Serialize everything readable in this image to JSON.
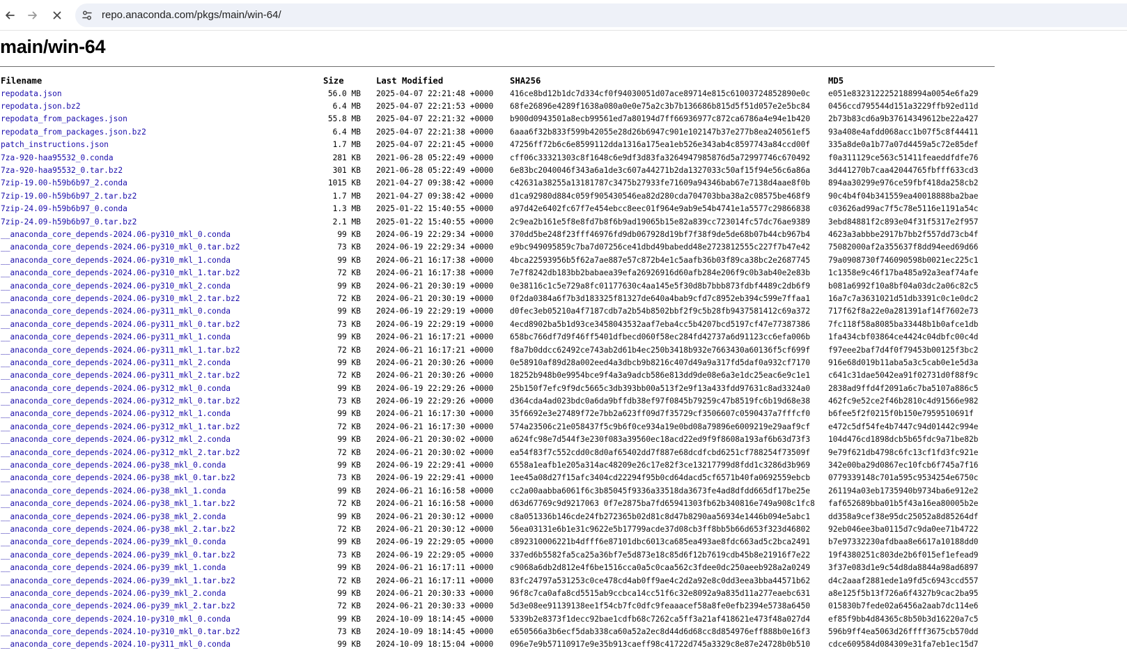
{
  "browser": {
    "url": "repo.anaconda.com/pkgs/main/win-64/"
  },
  "page": {
    "title": "main/win-64"
  },
  "table": {
    "headers": {
      "filename": "Filename",
      "size": "Size",
      "modified": "Last Modified",
      "sha256": "SHA256",
      "md5": "MD5"
    },
    "rows": [
      [
        "repodata.json",
        "56.0 MB",
        "2025-04-07 22:21:48 +0000",
        "416ce8bd12b1dc7d334cf0f94030051d07ace89714e815c61003724852890e0c",
        "e051e8323122252188994a0054e6fa29"
      ],
      [
        "repodata.json.bz2",
        "6.4 MB",
        "2025-04-07 22:21:53 +0000",
        "68fe26896e4289f1638a080a0e0e75a2c3b7b136686b815d5f51d057e2e5bc84",
        "0456ccd795544d151a3229ffb92ed11d"
      ],
      [
        "repodata_from_packages.json",
        "55.8 MB",
        "2025-04-07 22:21:32 +0000",
        "b900d0943501a8ecb99561ed7a80194d7ff66936977c872ca6786a4e94e1b420",
        "2b73b83cd6a9b37614349612be22a427"
      ],
      [
        "repodata_from_packages.json.bz2",
        "6.4 MB",
        "2025-04-07 22:21:38 +0000",
        "6aaa6f32b833f599b42055e28d26b6947c901e102147b37e277b8ea240561ef5",
        "93a408e4afdd068acc1b07f5c8f44411"
      ],
      [
        "patch_instructions.json",
        "1.7 MB",
        "2025-04-07 22:21:45 +0000",
        "47256ff72b6c6e8599112dda1316a175ea1eb526e343ab4c8597743a84ccd00f",
        "335a8de0a1b77a07d4459a5c72e85def"
      ],
      [
        "7za-920-haa95532_0.conda",
        "281 KB",
        "2021-06-28 05:22:49 +0000",
        "cff06c33321303c8f1648c6e9df3d83fa3264947985876d5a72997746c670492",
        "f0a311129ce563c51411feaeddfdfe76"
      ],
      [
        "7za-920-haa95532_0.tar.bz2",
        "301 KB",
        "2021-06-28 05:22:49 +0000",
        "6e83bc2040046f343a6a1de3c607a44271b2da1327033c50af15f94e56c6a86a",
        "3d441270b7caa42044765fbfff633cd3"
      ],
      [
        "7zip-19.00-h59b6b97_2.conda",
        "1015 KB",
        "2021-04-27 09:38:42 +0000",
        "c42631a38255a13181787c3475b27933fe71609a94346bab67e7138d4aae8f0b",
        "894aa30299e976ce59fbf418da258cb2"
      ],
      [
        "7zip-19.00-h59b6b97_2.tar.bz2",
        "1.7 MB",
        "2021-04-27 09:38:42 +0000",
        "d1ca92980d884c059f905430546ea82d280cda704703bba38a2c08575be468f9",
        "90c4b4f04b341559ea40018888ba2bae"
      ],
      [
        "7zip-24.09-h59b6b97_0.conda",
        "1.3 MB",
        "2025-01-22 15:40:55 +0000",
        "a97d42e6402fc67f7e454ebcc8eec01f964e9ab9e54b4741e1a5577c29866838",
        "c03626ad99ac7f5c78e5116e1191a54c"
      ],
      [
        "7zip-24.09-h59b6b97_0.tar.bz2",
        "2.1 MB",
        "2025-01-22 15:40:55 +0000",
        "2c9ea2b161e5f8e8fd7b8f6b9ad19065b15e82a839cc723014fc57dc76ae9389",
        "3ebd84881f2c893e04f31f5317e2f957"
      ],
      [
        "__anaconda_core_depends-2024.06-py310_mkl_0.conda",
        "99 KB",
        "2024-06-19 22:29:34 +0000",
        "370dd5be248f23fff46976fd9db067928d19bf7f38f9de5de68b07b44cb967b4",
        "4623a3abbbe2917b7bb2f557dd73cb4f"
      ],
      [
        "__anaconda_core_depends-2024.06-py310_mkl_0.tar.bz2",
        "73 KB",
        "2024-06-19 22:29:34 +0000",
        "e9bc949095859c7ba7d07256ce41dbd49babedd48e2723812555c227f7b47e42",
        "75082000af2a355637f8dd94eed69d66"
      ],
      [
        "__anaconda_core_depends-2024.06-py310_mkl_1.conda",
        "99 KB",
        "2024-06-21 16:17:38 +0000",
        "4bca22593956b5f62a7ae887e57c872b4e1c5aafb36b03f89ca38bc2e2687745",
        "79a0908730f746090598b0021ec225c1"
      ],
      [
        "__anaconda_core_depends-2024.06-py310_mkl_1.tar.bz2",
        "72 KB",
        "2024-06-21 16:17:38 +0000",
        "7e7f8242db183bb2babaea39efa26926916d60afb284e206f9c0b3ab40e2e83b",
        "1c1358e9c46f17ba485a92a3eaf74afe"
      ],
      [
        "__anaconda_core_depends-2024.06-py310_mkl_2.conda",
        "99 KB",
        "2024-06-21 20:30:19 +0000",
        "0e38116c1c5e729a8fc01177630c4aa145e5f30d8b7bbb873fdbf4489c2db6f9",
        "b081a6992f10a8bf04a03dc2a06c82c5"
      ],
      [
        "__anaconda_core_depends-2024.06-py310_mkl_2.tar.bz2",
        "72 KB",
        "2024-06-21 20:30:19 +0000",
        "0f2da0384a6f7b3d183325f81327de640a4bab9cfd7c8952eb394c599e7ffaa1",
        "16a7c7a3631021d51db3391c0c1e0dc2"
      ],
      [
        "__anaconda_core_depends-2024.06-py311_mkl_0.conda",
        "99 KB",
        "2024-06-19 22:29:19 +0000",
        "d0fec3eb05210a4f7187cdb7a2b54b8502bbf2f9c5b28fb9437581412c69a372",
        "717f62f8a22e0a281391af14f7602e73"
      ],
      [
        "__anaconda_core_depends-2024.06-py311_mkl_0.tar.bz2",
        "73 KB",
        "2024-06-19 22:29:19 +0000",
        "4ecd8902ba5b1d93ce3458043532aaf7eba4cc5b4207bcd5197cf47e77387386",
        "7fc118f58a8085ba33448b1b0afce1db"
      ],
      [
        "__anaconda_core_depends-2024.06-py311_mkl_1.conda",
        "99 KB",
        "2024-06-21 16:17:21 +0000",
        "658bc766df7d9f46ff5401dfbecd060f58ec284fd42737a6d91123cc6efa006b",
        "1fa434cbf03864ce4424c04dbfc00c4d"
      ],
      [
        "__anaconda_core_depends-2024.06-py311_mkl_1.tar.bz2",
        "72 KB",
        "2024-06-21 16:17:21 +0000",
        "f8a7b0ddcc62492ce743ab2d61b4ec250b3418b932e7663430a60136f5cf699f",
        "f97eee2baf7d4f0f79453b00125f3bc2"
      ],
      [
        "__anaconda_core_depends-2024.06-py311_mkl_2.conda",
        "99 KB",
        "2024-06-21 20:30:26 +0000",
        "0e58910af89d28a002eed4a3dbcb9b8216c407d49a9a317fd5daf0a932cf7170",
        "916e68d019b11aba5a3c5cab0e1e5d3a"
      ],
      [
        "__anaconda_core_depends-2024.06-py311_mkl_2.tar.bz2",
        "72 KB",
        "2024-06-21 20:30:26 +0000",
        "18252b948b0e9954bce9f4a3a9adcb586e813dd9de08e6a3e1dc25eac6e9c1e1",
        "c641c31dae5042ea91f02731d0f88f9c"
      ],
      [
        "__anaconda_core_depends-2024.06-py312_mkl_0.conda",
        "99 KB",
        "2024-06-19 22:29:26 +0000",
        "25b150f7efc9f9dc5665c3db393bb00a513f2e9f13a433fdd97631c8ad3324a0",
        "2838ad9ffd4f2091a6c7ba5107a886c5"
      ],
      [
        "__anaconda_core_depends-2024.06-py312_mkl_0.tar.bz2",
        "73 KB",
        "2024-06-19 22:29:26 +0000",
        "d364cda4ad023bdc0a6da9bffdb38ef97f0845b79259c47b8519fc6b19d68e38",
        "462fc9e52ce2f46b2810c4d91566e982"
      ],
      [
        "__anaconda_core_depends-2024.06-py312_mkl_1.conda",
        "99 KB",
        "2024-06-21 16:17:30 +0000",
        "35f6692e3e27489f72e7bb2a623ff09d7f35729cf3506607c0590437a7fffcf0",
        "b6fee5f2f0215f0b150e7959510691f"
      ],
      [
        "__anaconda_core_depends-2024.06-py312_mkl_1.tar.bz2",
        "72 KB",
        "2024-06-21 16:17:30 +0000",
        "574a23506c21e058437f5c9b6f0ce934a19e0bd08a79896e6009219e29aaf9cf",
        "e472c5df54fe4b7447c94d01442c994e"
      ],
      [
        "__anaconda_core_depends-2024.06-py312_mkl_2.conda",
        "99 KB",
        "2024-06-21 20:30:02 +0000",
        "a624fc98e7d544f3e230f083a39560ec18acd22ed9f9f8608a193af6b63d73f3",
        "104d476cd1898dcb5b65fdc9a71be82b"
      ],
      [
        "__anaconda_core_depends-2024.06-py312_mkl_2.tar.bz2",
        "72 KB",
        "2024-06-21 20:30:02 +0000",
        "ea54f83f7c552cdd0c8d0af65402dd7f887e68dcdfcbd6251cf788254f73509f",
        "9e79f621db4798c6fc13cf1fd3fc921e"
      ],
      [
        "__anaconda_core_depends-2024.06-py38_mkl_0.conda",
        "99 KB",
        "2024-06-19 22:29:41 +0000",
        "6558a1eafb1e205a314ac48209e26c17e82f3ce13217799d8fdd1c3286d3b969",
        "342e00ba29d0867ec10fcb6f745a7f16"
      ],
      [
        "__anaconda_core_depends-2024.06-py38_mkl_0.tar.bz2",
        "73 KB",
        "2024-06-19 22:29:41 +0000",
        "1ee45a08d27f15afc3404cd22294f95b0cd64dacd5cf6571b40fa0692559ebcb",
        "0779339148c701a595c9534254e6750c"
      ],
      [
        "__anaconda_core_depends-2024.06-py38_mkl_1.conda",
        "99 KB",
        "2024-06-21 16:16:58 +0000",
        "cc2a00aabba6061f6c3b85045f9336a33518da3673fe4ad8dfdd665df17be25e",
        "261194a03eb1735940b9734ba6e912e2"
      ],
      [
        "__anaconda_core_depends-2024.06-py38_mkl_1.tar.bz2",
        "72 KB",
        "2024-06-21 16:16:58 +0000",
        "d63d67769c9d9217063 0f7e2875ba7fd65941303fb62b340816e749a908c1fc8",
        "faf652689bba01b5f43a16ea80005b2e"
      ],
      [
        "__anaconda_core_depends-2024.06-py38_mkl_2.conda",
        "99 KB",
        "2024-06-21 20:30:12 +0000",
        "c8a051336b146cde24fb272365b02d81c8d47b8290aa56934e1446b094e5abc1",
        "dd358a9cef38e95dc25052a8d85264df"
      ],
      [
        "__anaconda_core_depends-2024.06-py38_mkl_2.tar.bz2",
        "72 KB",
        "2024-06-21 20:30:12 +0000",
        "56ea03131e6b1e31c9622e5b17799acde37d08cb3ff8bb5b66d653f323d46802",
        "92eb046ee3ba0115d7c9da0ee71b4722"
      ],
      [
        "__anaconda_core_depends-2024.06-py39_mkl_0.conda",
        "99 KB",
        "2024-06-19 22:29:05 +0000",
        "c892310006221b4dfff6e87101dbc6013ca685ea493ae8fdc663ad5c2bca2491",
        "b7e97332230afdbaa8e6617a10188dd0"
      ],
      [
        "__anaconda_core_depends-2024.06-py39_mkl_0.tar.bz2",
        "73 KB",
        "2024-06-19 22:29:05 +0000",
        "337ed6b5582fa5ca25a36bf7e5d873e18c85d6f12b7619cdb45b8e21916f7e22",
        "19f4380251c803de2b6f015ef1efead9"
      ],
      [
        "__anaconda_core_depends-2024.06-py39_mkl_1.conda",
        "99 KB",
        "2024-06-21 16:17:11 +0000",
        "c9068a6db2d812e4f6be1516cca0a5c0caa562c3fdee0dc250aeeb928a2a0249",
        "3f37e083d1e9c54d8da8844a98ad6897"
      ],
      [
        "__anaconda_core_depends-2024.06-py39_mkl_1.tar.bz2",
        "72 KB",
        "2024-06-21 16:17:11 +0000",
        "83fc24797a531253c0ce478cd4ab0ff9ae4c2d2a92e8c0dd3eea3bba44571b62",
        "d4c2aaaf2881ede1a9fd5c6943ccd557"
      ],
      [
        "__anaconda_core_depends-2024.06-py39_mkl_2.conda",
        "99 KB",
        "2024-06-21 20:30:33 +0000",
        "96f8c7ca0afa8cd5515ab9ccbca14cc51f6c32e8092a9a835d11a277eaebc631",
        "a8e125f5b13f726a6f4327b9cac2ba95"
      ],
      [
        "__anaconda_core_depends-2024.06-py39_mkl_2.tar.bz2",
        "72 KB",
        "2024-06-21 20:30:33 +0000",
        "5d3e08ee91139138ee1f54cb7fc0dfc9feaaacef58a8fe0efb2394e5738a6450",
        "015830b7fede02a6456a2aab7dc114e6"
      ],
      [
        "__anaconda_core_depends-2024.10-py310_mkl_0.conda",
        "99 KB",
        "2024-10-09 18:14:45 +0000",
        "5339b2e8373f1decc92bae1cdfb68c7262ca5ff3a21af418621e473f48a027d4",
        "ef85f9bb4d84365c8b50b3d16220a7c5"
      ],
      [
        "__anaconda_core_depends-2024.10-py310_mkl_0.tar.bz2",
        "73 KB",
        "2024-10-09 18:14:45 +0000",
        "e650566a3b6ecf5dab338ca60a52a2ec8d44d6d68cc8d854976eff888b0e16f3",
        "596b9ff4ea5063d26ffff3675cb570dd"
      ],
      [
        "__anaconda_core_depends-2024.10-py311_mkl_0.conda",
        "99 KB",
        "2024-10-09 18:15:04 +0000",
        "096e7e9b57110917e9e35b913caeff98c41722d745a3329c8e87e24728b0b510",
        "cdce609584d084309e31fa7eb1ec15d7"
      ]
    ]
  }
}
